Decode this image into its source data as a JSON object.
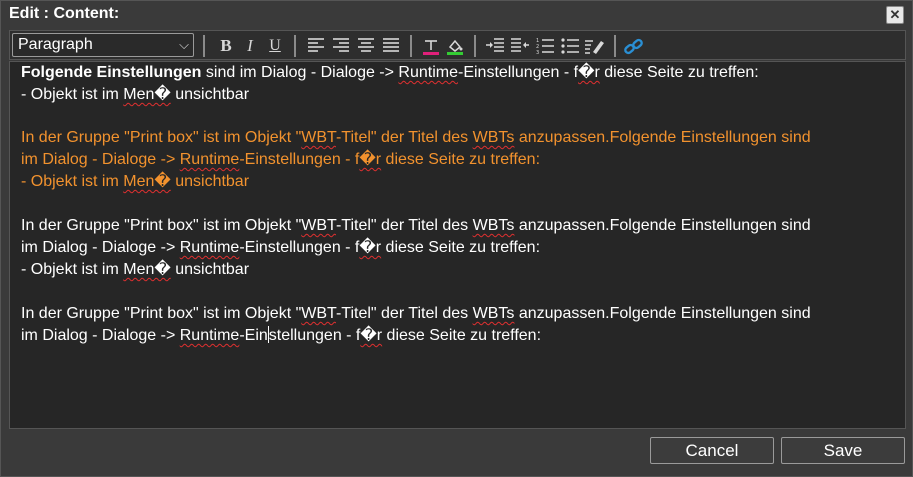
{
  "dialog": {
    "title": "Edit : Content:"
  },
  "toolbar": {
    "format_select": "Paragraph"
  },
  "colors": {
    "accent_orange": "#f2922e",
    "font_color_bar": "#e0207a",
    "bg_color_bar": "#33cc33",
    "link_icon": "#2a8fd4"
  },
  "editor": {
    "p1": {
      "l1_bold": "Folgende Einstellungen",
      "l1_a": " sind im Dialog - Dialoge -> ",
      "l1_b": "Runtime",
      "l1_c": "-Einstellungen - f",
      "l1_d": "�r",
      "l1_e": " diese Seite zu treffen:",
      "l2_a": "- Objekt ist im ",
      "l2_b": "Men�",
      "l2_c": " unsichtbar"
    },
    "p2": {
      "l1_a": "In der Gruppe \"Print box\" ist im Objekt \"",
      "l1_b": "WBT",
      "l1_c": "-Titel\" der Titel des ",
      "l1_d": "WBTs",
      "l1_e": " anzupassen.Folgende Einstellungen sind",
      "l2_a": "im Dialog - Dialoge -> ",
      "l2_b": "Runtime",
      "l2_c": "-Einstellungen - f",
      "l2_d": "�r",
      "l2_e": " diese Seite zu treffen:",
      "l3_a": "- Objekt ist im ",
      "l3_b": "Men�",
      "l3_c": " unsichtbar"
    },
    "p3": {
      "l1_a": "In der Gruppe \"Print box\" ist im Objekt \"",
      "l1_b": "WBT",
      "l1_c": "-Titel\" der Titel des ",
      "l1_d": "WBTs",
      "l1_e": " anzupassen.Folgende Einstellungen sind",
      "l2_a": "im Dialog - Dialoge -> ",
      "l2_b": "Runtime",
      "l2_c": "-Einstellungen - f",
      "l2_d": "�r",
      "l2_e": " diese Seite zu treffen:",
      "l3_a": "- Objekt ist im ",
      "l3_b": "Men�",
      "l3_c": " unsichtbar"
    },
    "p4": {
      "l1_a": "In der Gruppe \"Print box\" ist im Objekt \"",
      "l1_b": "WBT",
      "l1_c": "-Titel\" der Titel des ",
      "l1_d": "WBTs",
      "l1_e": " anzupassen.Folgende Einstellungen sind",
      "l2_a": "im Dialog - Dialoge -> ",
      "l2_b": "Runtime",
      "l2_c": "-Ein",
      "l2_c2": "stellungen - f",
      "l2_d": "�r",
      "l2_e": " diese Seite zu treffen:"
    }
  },
  "footer": {
    "cancel_label": "Cancel",
    "save_label": "Save"
  }
}
